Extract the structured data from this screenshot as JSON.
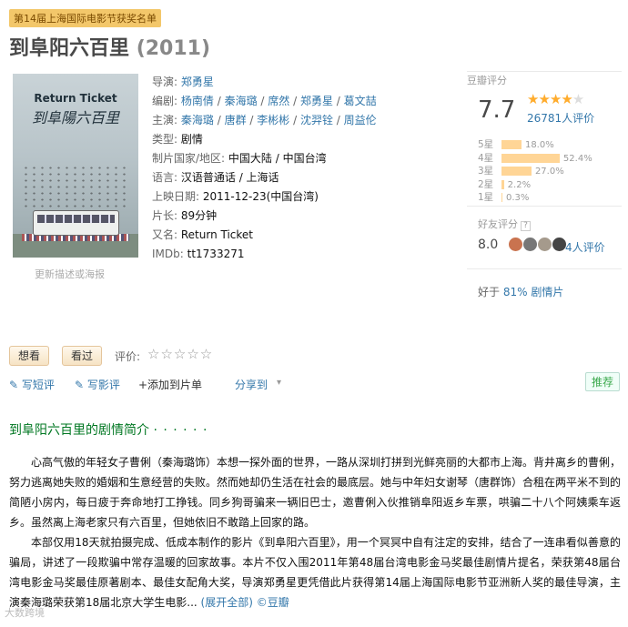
{
  "award_tag": "第14届上海国际电影节获奖名单",
  "title": "到阜阳六百里",
  "year": "(2011)",
  "poster": {
    "title_en": "Return Ticket",
    "title_cn": "到阜陽六百里",
    "link": "更新描述或海报"
  },
  "info": {
    "director_label": "导演:",
    "director": "郑勇星",
    "writer_label": "编剧:",
    "writers": [
      "杨南倩",
      "秦海璐",
      "席然",
      "郑勇星",
      "葛文喆"
    ],
    "cast_label": "主演:",
    "cast": [
      "秦海璐",
      "唐群",
      "李彬彬",
      "沈羿铨",
      "周益伦"
    ],
    "genre_label": "类型:",
    "genre": "剧情",
    "country_label": "制片国家/地区:",
    "country": "中国大陆 / 中国台湾",
    "language_label": "语言:",
    "language": "汉语普通话 / 上海话",
    "release_label": "上映日期:",
    "release": "2011-12-23(中国台湾)",
    "runtime_label": "片长:",
    "runtime": "89分钟",
    "aka_label": "又名:",
    "aka": "Return Ticket",
    "imdb_label": "IMDb:",
    "imdb": "tt1733271"
  },
  "rating": {
    "header": "豆瓣评分",
    "score": "7.7",
    "stars": "★★★★",
    "stars_off": "★",
    "votes": "26781人评价",
    "distribution": [
      {
        "label": "5星",
        "pct": "18.0%",
        "value": 18.0
      },
      {
        "label": "4星",
        "pct": "52.4%",
        "value": 52.4
      },
      {
        "label": "3星",
        "pct": "27.0%",
        "value": 27.0
      },
      {
        "label": "2星",
        "pct": "2.2%",
        "value": 2.2
      },
      {
        "label": "1星",
        "pct": "0.3%",
        "value": 0.3
      }
    ],
    "friend_header": "好友评分",
    "friend_q": "?",
    "friend_score": "8.0",
    "friend_count": "4人评价",
    "better_prefix": "好于",
    "better_pct": "81%",
    "better_suffix": "剧情片"
  },
  "buttons": {
    "want": "想看",
    "watched": "看过",
    "rate_label": "评价:",
    "rate_stars": "☆☆☆☆☆"
  },
  "actions": {
    "short_review": "✎ 写短评",
    "review": "✎ 写影评",
    "add_list": "+添加到片单",
    "share": "分享到",
    "share_caret": "▾",
    "recommend": "推荐"
  },
  "summary": {
    "title": "到阜阳六百里的剧情简介",
    "dots": "· · · · · ·",
    "text": "心高气傲的年轻女子曹俐（秦海璐饰）本想一探外面的世界，一路从深圳打拼到光鲜亮丽的大都市上海。背井离乡的曹俐，努力逃离她失败的婚姻和生意经营的失败。然而她却仍生活在社会的最底层。她与中年妇女谢琴（唐群饰）合租在两平米不到的简陋小房内，每日疲于奔命地打工挣钱。同乡狗哥骗来一辆旧巴士，邀曹俐入伙推销阜阳返乡车票，哄骗二十八个阿姨乘车返乡。虽然离上海老家只有六百里，但她依旧不敢踏上回家的路。",
    "text2": "本部仅用18天就拍摄完成、低成本制作的影片《到阜阳六百里》，用一个冥冥中自有注定的安排，结合了一连串看似善意的骗局，讲述了一段欺骗中常存温暖的回家故事。本片不仅入围2011年第48届台湾电影金马奖最佳剧情片提名，荣获第48届台湾电影金马奖最佳原著剧本、最佳女配角大奖，导演郑勇星更凭借此片获得第14届上海国际电影节亚洲新人奖的最佳导演，主演秦海璐荣获第18届北京大学生电影...",
    "expand": "(展开全部)",
    "source": "©豆瓣"
  },
  "watermark": "大数跨境"
}
